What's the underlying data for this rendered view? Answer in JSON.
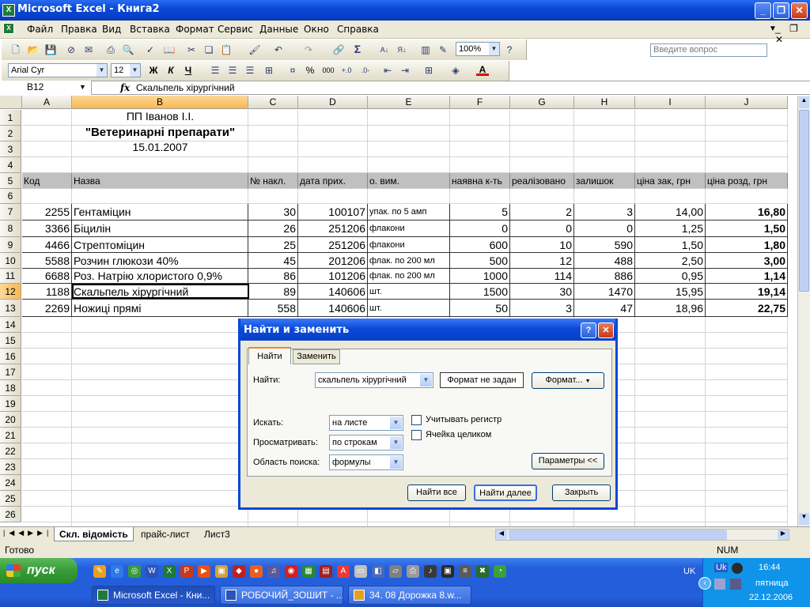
{
  "window": {
    "title": "Microsoft Excel - Книга2"
  },
  "menu": [
    "Файл",
    "Правка",
    "Вид",
    "Вставка",
    "Формат",
    "Сервис",
    "Данные",
    "Окно",
    "Справка"
  ],
  "ask_placeholder": "Введите вопрос",
  "toolbar": {
    "zoom": "100%",
    "font": "Arial Cyr",
    "size": "12",
    "bold": "Ж",
    "italic": "К",
    "underline": "Ч",
    "percent": "%",
    "thousands": "000",
    "sigma": "Σ",
    "font_color_icon": "A"
  },
  "formula": {
    "namebox": "B12",
    "fx": "fx",
    "value": "Скальпель хірургічний"
  },
  "columns": [
    "A",
    "B",
    "C",
    "D",
    "E",
    "F",
    "G",
    "H",
    "I",
    "J"
  ],
  "rows": [
    "1",
    "2",
    "3",
    "4",
    "5",
    "6",
    "7",
    "8",
    "9",
    "10",
    "11",
    "12",
    "13",
    "14",
    "15",
    "16",
    "17",
    "18",
    "19",
    "20",
    "21",
    "22",
    "23",
    "24",
    "25",
    "26"
  ],
  "sheet": {
    "title1": "ПП Іванов І.І.",
    "title2": "\"Ветеринарні препарати\"",
    "date": "15.01.2007",
    "headers": [
      "Код",
      "Назва",
      "№ накл.",
      "дата прих.",
      "о. вим.",
      "наявна к-ть",
      "реалізовано",
      "залишок",
      "ціна зак, грн",
      "ціна розд, грн"
    ],
    "data": [
      [
        "2255",
        "Гентаміцин",
        "30",
        "100107",
        "упак. по 5 амп",
        "5",
        "2",
        "3",
        "14,00",
        "16,80"
      ],
      [
        "3366",
        "Біцилін",
        "26",
        "251206",
        "флакони",
        "0",
        "0",
        "0",
        "1,25",
        "1,50"
      ],
      [
        "4466",
        "Стрептоміцин",
        "25",
        "251206",
        "флакони",
        "600",
        "10",
        "590",
        "1,50",
        "1,80"
      ],
      [
        "5588",
        "Розчин глюкози 40%",
        "45",
        "201206",
        "флак. по 200 мл",
        "500",
        "12",
        "488",
        "2,50",
        "3,00"
      ],
      [
        "6688",
        "Роз. Натрію хлористого 0,9%",
        "86",
        "101206",
        "флак. по 200 мл",
        "1000",
        "114",
        "886",
        "0,95",
        "1,14"
      ],
      [
        "1188",
        "Скальпель хірургічний",
        "89",
        "140606",
        "шт.",
        "1500",
        "30",
        "1470",
        "15,95",
        "19,14"
      ],
      [
        "2269",
        "Ножиці прямі",
        "558",
        "140606",
        "шт.",
        "50",
        "3",
        "47",
        "18,96",
        "22,75"
      ]
    ]
  },
  "tabs": [
    "Скл. відомість",
    "прайс-лист",
    "Лист3"
  ],
  "status": {
    "left": "Готово",
    "num": "NUM"
  },
  "dialog": {
    "title": "Найти и заменить",
    "tab_find": "Найти",
    "tab_replace": "Заменить",
    "find_label": "Найти:",
    "find_value": "скальпель хірургічний",
    "format_status": "Формат не задан",
    "format_btn": "Формат...",
    "search_label": "Искать:",
    "search_value": "на листе",
    "look_label": "Просматривать:",
    "look_value": "по строкам",
    "area_label": "Область поиска:",
    "area_value": "формулы",
    "match_case": "Учитывать регистр",
    "whole_cell": "Ячейка целиком",
    "params_btn": "Параметры <<",
    "find_all": "Найти все",
    "find_next": "Найти далее",
    "close": "Закрыть"
  },
  "taskbar": {
    "start": "пуск",
    "tasks": [
      "Microsoft Excel - Кни...",
      "РОБОЧИЙ_ЗОШИТ - ...",
      "34. 08 Дорожка 8.w..."
    ],
    "lang": "UK",
    "lang2": "Uk",
    "time": "16:44",
    "day": "пятница",
    "date": "22.12.2006"
  }
}
